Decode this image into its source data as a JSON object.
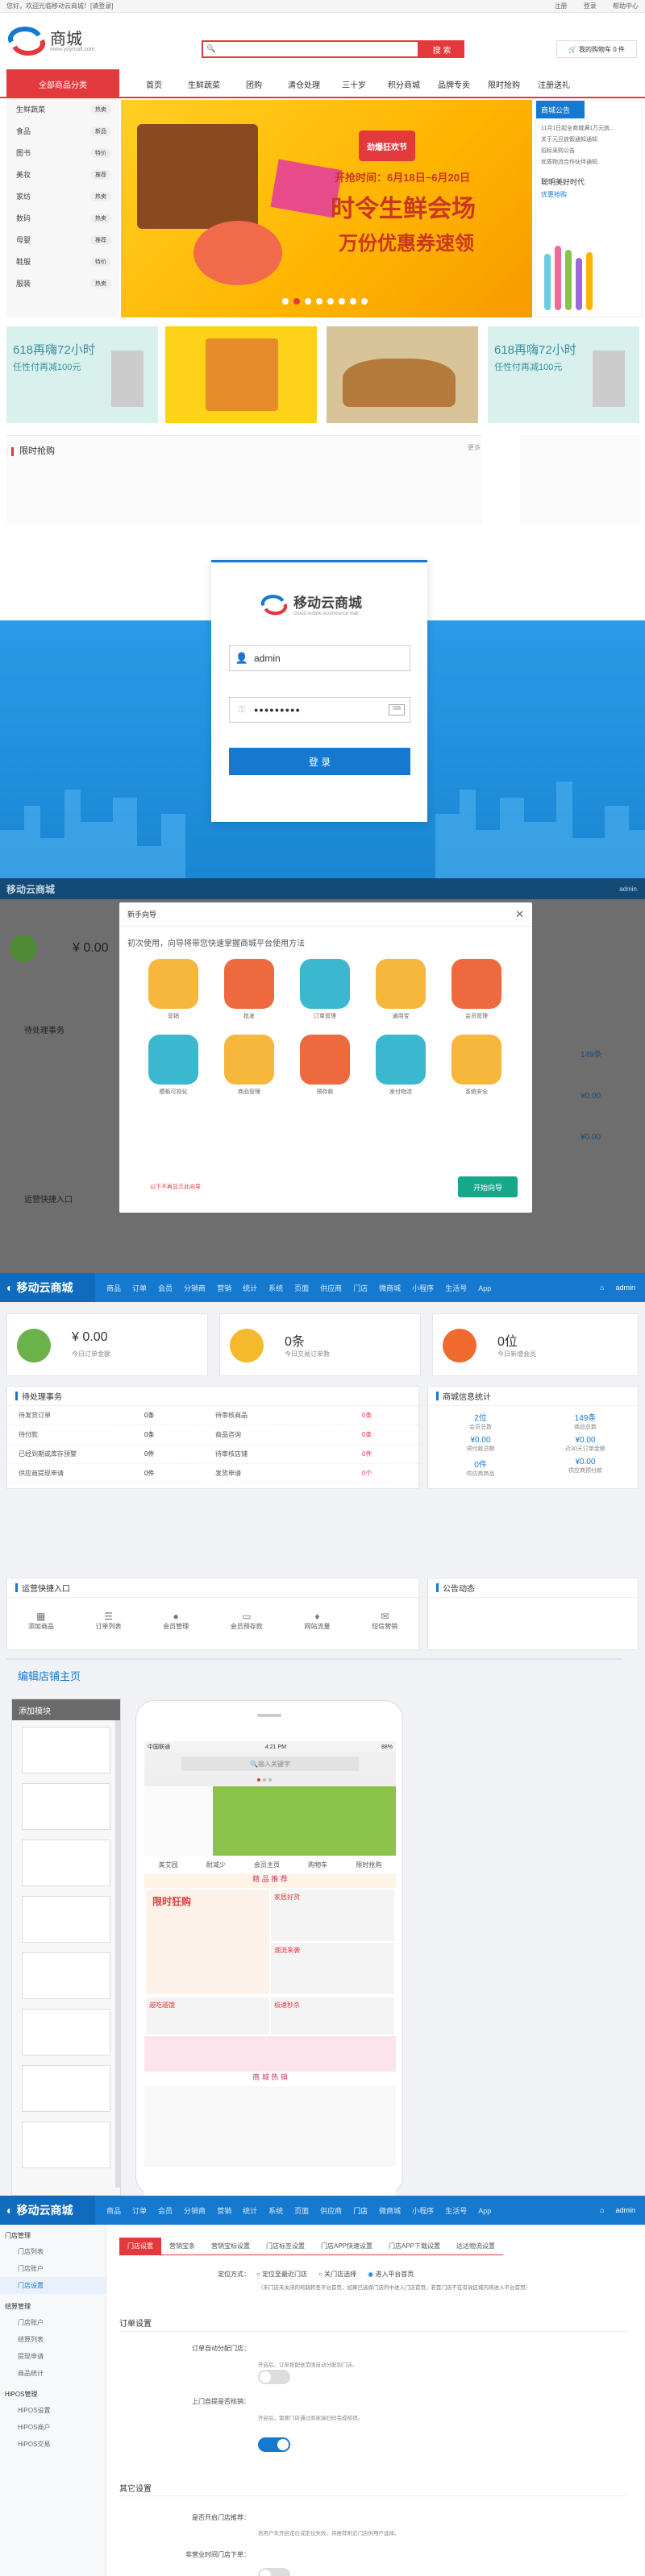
{
  "mall": {
    "topbar_left": "您好，欢迎光临移动云商城！[请登录]",
    "topbar_links": [
      "注册",
      "登录",
      "帮助中心"
    ],
    "logo": "商城",
    "logo_sub": "www.ydymall.com",
    "search_button": "搜 索",
    "cart": "我的购物车 0 件",
    "all_categories": "全部商品分类",
    "nav": [
      "首页",
      "生鲜蔬菜",
      "团购",
      "清仓处理",
      "三十岁",
      "积分商城",
      "品牌专卖",
      "限时抢购",
      "注册送礼"
    ],
    "categories": [
      {
        "name": "生鲜蔬菜",
        "tag": "热卖"
      },
      {
        "name": "食品",
        "tag": "新品"
      },
      {
        "name": "图书",
        "tag": "特价"
      },
      {
        "name": "美妆",
        "tag": "推荐"
      },
      {
        "name": "家纺",
        "tag": "热卖"
      },
      {
        "name": "数码",
        "tag": "热卖"
      },
      {
        "name": "母婴",
        "tag": "推荐"
      },
      {
        "name": "鞋服",
        "tag": "特价"
      },
      {
        "name": "服装",
        "tag": "热卖"
      }
    ],
    "banner_badge": "劲爆狂欢节",
    "banner_date": "开抢时间：6月18日~6月20日",
    "banner_main": "时令生鲜会场",
    "banner_sub": "万份优惠券速领",
    "notice_title": "商城公告",
    "notices": [
      "11月1日起全商城满1万元就...",
      "关于元旦放假通知通知",
      "招标采购公告",
      "优质物流合作伙伴通知"
    ],
    "right_promo": "聪明美好时代",
    "right_promo_sub": "优惠抢购",
    "promos": [
      {
        "title": "618再嗨72小时",
        "sub": "任性付再减100元"
      },
      {
        "title": "",
        "sub": ""
      },
      {
        "title": "",
        "sub": ""
      },
      {
        "title": "618再嗨72小时",
        "sub": "任性付再减100元"
      }
    ],
    "flash_title": "限时抢购",
    "flash_more": "更多"
  },
  "login": {
    "brand": "移动云商城",
    "brand_sub": "Cloud mobile ecommerce mall",
    "username": "admin",
    "password": "●●●●●●●●●",
    "button": "登  录"
  },
  "modal": {
    "brand": "移动云商城",
    "user": "admin",
    "title": "新手向导",
    "intro": "初次使用，向导将带您快速掌握商城平台使用方法",
    "icons": [
      "营销",
      "批发",
      "订单管理",
      "通用宝",
      "会员管理",
      "模板可视化",
      "商品管理",
      "预存款",
      "发付物流",
      "系统安全"
    ],
    "footer_link": "以下不再显示此向导",
    "start": "开始向导",
    "bg_amount": "¥ 0.00",
    "bg_stats": [
      "149条",
      "¥0.00",
      "¥0.00"
    ],
    "bg_todo": "待处理事务",
    "bg_quick": "运营快捷入口"
  },
  "admin": {
    "brand": "移动云商城",
    "user": "admin",
    "menu": [
      "商品",
      "订单",
      "会员",
      "分销商",
      "营销",
      "统计",
      "系统",
      "页面",
      "供应商",
      "门店",
      "微商城",
      "小程序",
      "生活号",
      "App"
    ],
    "stats": [
      {
        "value": "¥ 0.00",
        "label": "今日订单金额",
        "color": "#6bb24a"
      },
      {
        "value": "0条",
        "label": "今日交易订单数",
        "color": "#f4b92d"
      },
      {
        "value": "0位",
        "label": "今日新增会员",
        "color": "#f06a2d"
      }
    ],
    "todo_title": "待处理事务",
    "todo": [
      {
        "l": "待发货订单",
        "lv": "0条",
        "r": "待审核商品",
        "rv": "0条"
      },
      {
        "l": "待付款",
        "lv": "0条",
        "r": "商品咨询",
        "rv": "0条"
      },
      {
        "l": "已经到期或库存预警",
        "lv": "0件",
        "r": "待审核店铺",
        "rv": "0件"
      },
      {
        "l": "供应商提现申请",
        "lv": "0件",
        "r": "发货申请",
        "rv": "0个"
      }
    ],
    "info_title": "商城信息统计",
    "info": [
      {
        "v": "2位",
        "l": "会员总数"
      },
      {
        "v": "149条",
        "l": "商品总数"
      },
      {
        "v": "¥0.00",
        "l": "预付款总额"
      },
      {
        "v": "¥0.00",
        "l": "近30天订单金额"
      },
      {
        "v": "0件",
        "l": "供应商商品"
      },
      {
        "v": "¥0.00",
        "l": "供应商预付款"
      }
    ],
    "quick_title": "运营快捷入口",
    "quick": [
      "添加商品",
      "订单列表",
      "会员管理",
      "会员预存款",
      "网站流量",
      "短信营销"
    ],
    "notice_title": "公告动态",
    "edit_title": "编辑店铺主页",
    "module_title": "添加模块",
    "phone_status_left": "中国联通",
    "phone_time": "4:21 PM",
    "phone_battery": "88%",
    "phone_search": "输入关键字",
    "phone_quick": [
      "美艾园",
      "耐减少",
      "会员主页",
      "购物车",
      "限时抢购"
    ],
    "phone_sec1": "精 品 推 荐",
    "phone_sec2": "商 城 热 销",
    "phone_promo": "限时狂购",
    "phone_items": [
      "家居好货",
      "潮流来袭",
      "越吃越饿",
      "极速秒杀"
    ]
  },
  "settings": {
    "brand": "移动云商城",
    "user": "admin",
    "menu": [
      "商品",
      "订单",
      "会员",
      "分销商",
      "营销",
      "统计",
      "系统",
      "页面",
      "供应商",
      "门店",
      "微商城",
      "小程序",
      "生活号",
      "App"
    ],
    "sidebar": [
      {
        "group": "门店管理",
        "items": [
          "门店列表",
          "门店账户",
          "门店设置"
        ]
      },
      {
        "group": "结算管理",
        "items": [
          "门店账户",
          "结算列表",
          "提现申请",
          "商品统计"
        ]
      },
      {
        "group": "HiPOS管理",
        "items": [
          "HiPOS设置",
          "HiPOS商户",
          "HiPOS交易"
        ]
      }
    ],
    "tabs": [
      "门店设置",
      "营销宝条",
      "营销宝标设置",
      "门店标签设置",
      "门店APP快速设置",
      "门店APP下载设置",
      "达达物流设置"
    ],
    "location_label": "定位方式：",
    "location_options": [
      "定位至最近门店",
      "关门店选择",
      "进入平台首页"
    ],
    "location_hint": "（未门店未关闭的将跳转至平台首页，如果已选择门店的中进入门店首页，若是门店不在有效区域内将进入平台首页）",
    "section1": "订单设置",
    "rows": [
      {
        "label": "订单自动分配门店：",
        "on": false,
        "hint": "开启后，订单按配送范围自动分配到门店。"
      },
      {
        "label": "上门自提是否核销：",
        "on": true,
        "hint": "开启后，需要门店通过商家端扫码完成核销。"
      }
    ],
    "section2": "其它设置",
    "rows2": [
      {
        "label": "是否开启门店推荐：",
        "on": false,
        "hint": "若用户未开启定位或定位失败，将推荐附近门店供用户选择。"
      },
      {
        "label": "非营业时间门店下单：",
        "on": false,
        "hint": ""
      }
    ]
  }
}
